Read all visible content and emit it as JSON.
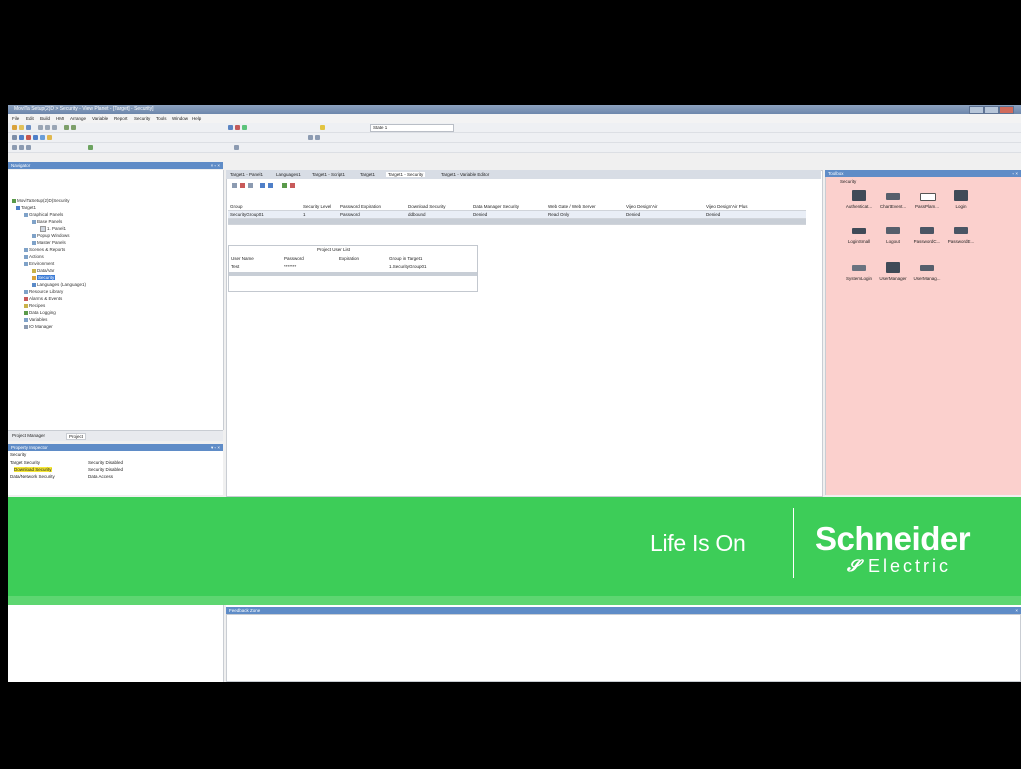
{
  "app": {
    "title": "MoviTa Setup(2)D > Security - View Planet - [Target] - Security]",
    "menus": [
      "File",
      "Edit",
      "Build",
      "HMI",
      "Arrange",
      "Variable",
      "Report",
      "Security",
      "Tools",
      "Window",
      "Help"
    ],
    "toolbar_state": "State 1"
  },
  "navigator": {
    "header": "Navigator",
    "tree": [
      "MoviTaSetup(2)D(Security",
      "Target1",
      "Graphical Panels",
      "Base Panels",
      "1. Panel1",
      "Popup Windows",
      "Master Panels",
      "Scenes & Reports",
      "Actions",
      "Environment",
      "Data/Var",
      "Security",
      "Languages (Language1)",
      "Resource Library",
      "Alarms & Events",
      "Recipes",
      "Data Logging",
      "Variables",
      "IO Manager"
    ],
    "tabs": [
      "Project Manager",
      "Project"
    ]
  },
  "properties": {
    "header": "Property Inspector",
    "category": "Security",
    "rows": [
      {
        "name": "Target Security",
        "value": "Security Disabled"
      },
      {
        "name": "Download Security",
        "value": "Security Disabled"
      },
      {
        "name": "Data/Network Security",
        "value": "Data Access"
      },
      {
        "name": "Vijeo Design'Air Security",
        "value": "Security Disabled"
      },
      {
        "name": "Security Level",
        "value": "Not Active"
      }
    ]
  },
  "editor": {
    "tabs": [
      "Target1 - Panel1",
      "Languages1",
      "Target1 - Script1",
      "Target1",
      "Target1 - Security",
      "Target1 - Variable Editor"
    ],
    "security_table": {
      "headers": [
        "Group",
        "Security Level",
        "Password Expiration",
        "Download Security",
        "Data Manager Security",
        "Web Gate / Web Server",
        "Vijeo Design'Air",
        "Vijeo Design'Air Plus"
      ],
      "rows": [
        [
          "SecurityGroup01",
          "1",
          "Password",
          "ddbound",
          "Denied",
          "Read Only",
          "Denied",
          "Denied"
        ]
      ]
    },
    "user_list": {
      "title": "Project User List",
      "headers": [
        "User Name",
        "Password",
        "Expiration",
        "Group in Target1"
      ],
      "rows": [
        [
          "Test",
          "*******",
          "",
          "1.SecurityGroup01"
        ]
      ]
    }
  },
  "toolbox": {
    "header": "Toolbox",
    "section": "Security",
    "items": [
      "Authenticat...",
      "ChartEvent...",
      "PassPlam...",
      "Login",
      "LoginSmall",
      "Logout",
      "PasswordC...",
      "PasswordE...",
      "SystemLogin",
      "UserManager",
      "UserManag..."
    ]
  },
  "feedback": {
    "header": "Feedback Zone"
  },
  "banner": {
    "slogan": "Life Is On",
    "brand": "Schneider",
    "brand_sub": "Electric",
    "color": "#3dcd58"
  },
  "colors": {
    "panel_header": "#5f8cc7",
    "toolbox_bg": "#fbd0cd",
    "selection": "#3b7bd6",
    "highlight": "#f6e836"
  }
}
